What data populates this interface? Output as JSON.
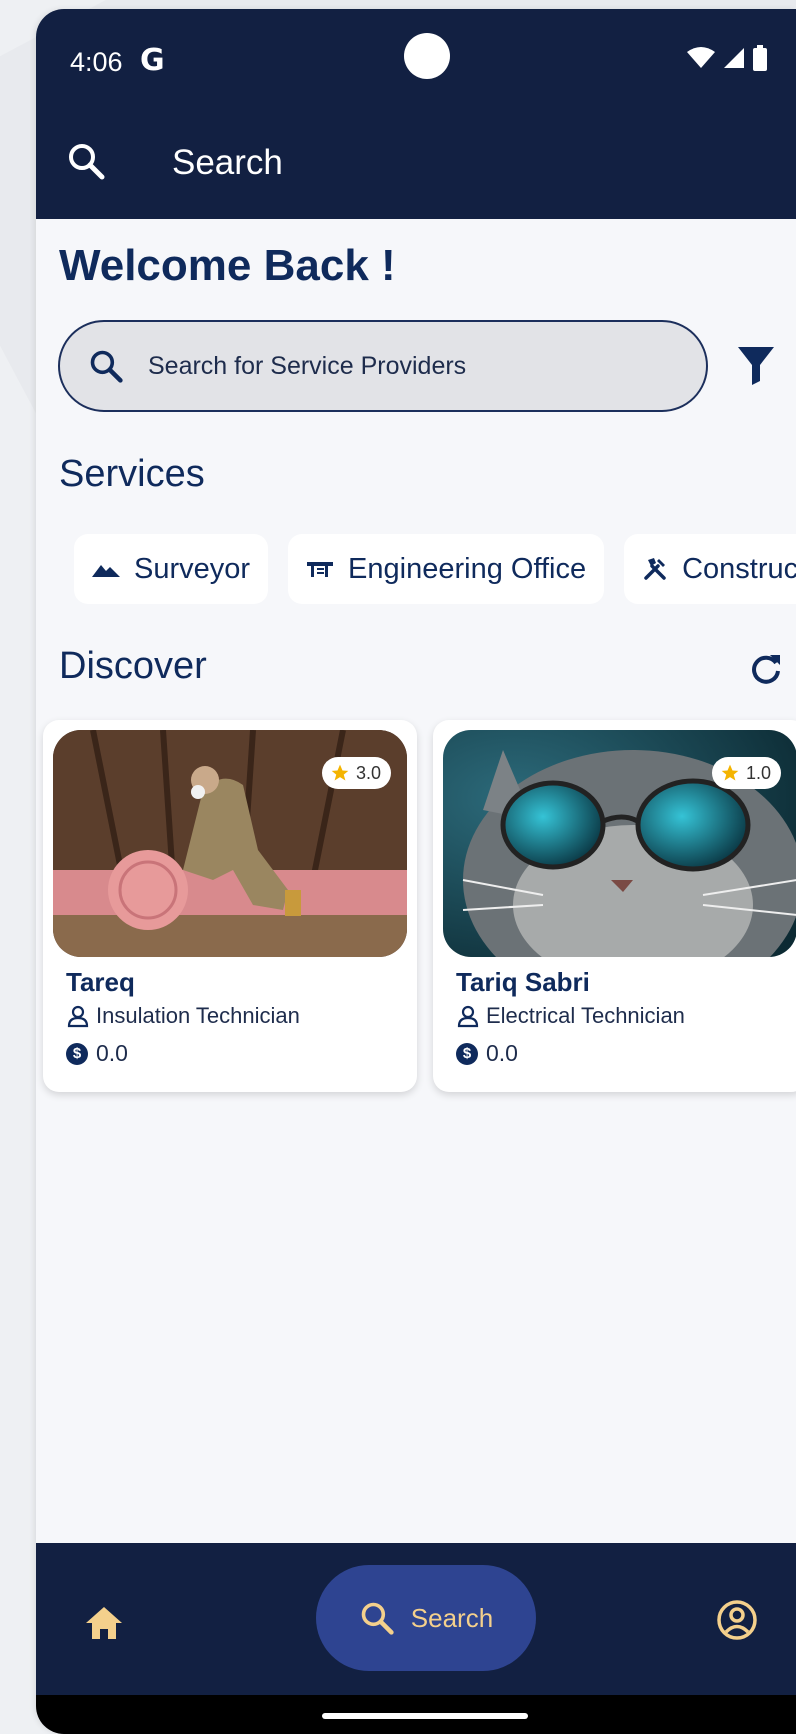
{
  "status_bar": {
    "time": "4:06",
    "google_glyph": "G"
  },
  "app_bar": {
    "title": "Search"
  },
  "welcome": "Welcome Back !",
  "search": {
    "placeholder": "Search for Service Providers"
  },
  "services": {
    "title": "Services",
    "items": [
      {
        "label": "Surveyor",
        "icon": "landscape-icon"
      },
      {
        "label": "Engineering Office",
        "icon": "office-icon"
      },
      {
        "label": "Construct",
        "icon": "tools-icon"
      }
    ]
  },
  "discover": {
    "title": "Discover",
    "cards": [
      {
        "name": "Tareq",
        "role": "Insulation Technician",
        "price": "0.0",
        "rating": "3.0",
        "image": "worker-insulation-photo"
      },
      {
        "name": "Tariq Sabri",
        "role": "Electrical Technician",
        "price": "0.0",
        "rating": "1.0",
        "image": "cat-sunglasses-photo"
      }
    ]
  },
  "bottom_nav": {
    "search_label": "Search"
  },
  "colors": {
    "primary_dark": "#122042",
    "accent_text": "#0f2a5c",
    "nav_active": "#2e4491",
    "nav_label": "#f4d08c",
    "star": "#f4b400"
  }
}
